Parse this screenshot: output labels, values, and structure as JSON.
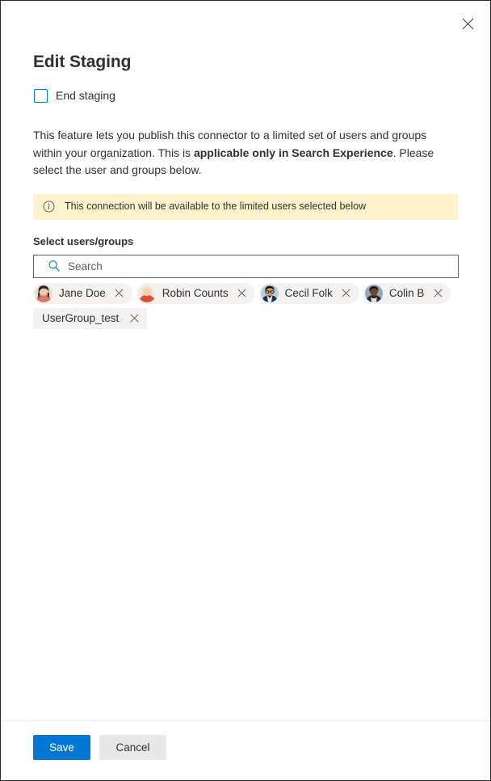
{
  "panel": {
    "title": "Edit Staging",
    "close_label": "Close",
    "close_icon": "close-icon"
  },
  "end_staging": {
    "label": "End staging",
    "checked": false
  },
  "description": {
    "part1": "This feature lets you publish this connector to a limited set of users and groups within your organization. This is ",
    "emphasis": "applicable only in Search Experience",
    "part2": ". Please select the user and groups below."
  },
  "info_banner": {
    "icon": "info-circle-icon",
    "text": "This connection will be available to the limited users selected below",
    "background_color": "#fff4ce"
  },
  "picker": {
    "label": "Select users/groups",
    "search": {
      "icon": "search-icon",
      "placeholder": "Search",
      "value": ""
    },
    "selected": [
      {
        "name": "Jane Doe",
        "type": "person",
        "remove_label": "Remove Jane Doe"
      },
      {
        "name": "Robin Counts",
        "type": "person",
        "remove_label": "Remove Robin Counts"
      },
      {
        "name": "Cecil Folk",
        "type": "person",
        "remove_label": "Remove Cecil Folk"
      },
      {
        "name": "Colin B",
        "type": "person",
        "remove_label": "Remove Colin B"
      },
      {
        "name": "UserGroup_test",
        "type": "group",
        "remove_label": "Remove UserGroup_test"
      }
    ]
  },
  "footer": {
    "save_label": "Save",
    "cancel_label": "Cancel",
    "primary_color": "#0078d4"
  }
}
